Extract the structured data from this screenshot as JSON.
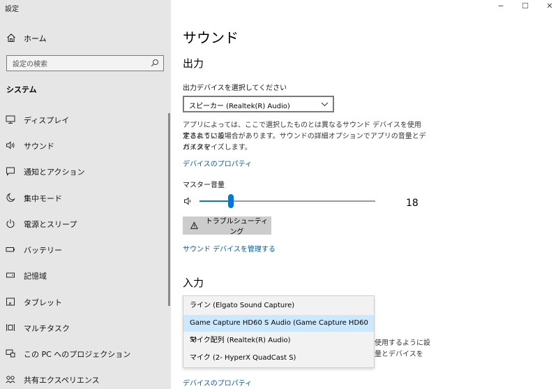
{
  "window": {
    "title": "設定",
    "minimize": "−",
    "maximize": "☐",
    "close": "✕"
  },
  "sidebar": {
    "home_label": "ホーム",
    "search_placeholder": "設定の検索",
    "section_title": "システム",
    "items": [
      {
        "label": "ディスプレイ",
        "icon": "display-icon"
      },
      {
        "label": "サウンド",
        "icon": "speaker-icon"
      },
      {
        "label": "通知とアクション",
        "icon": "notification-icon"
      },
      {
        "label": "集中モード",
        "icon": "moon-icon"
      },
      {
        "label": "電源とスリープ",
        "icon": "power-icon"
      },
      {
        "label": "バッテリー",
        "icon": "battery-icon"
      },
      {
        "label": "記憶域",
        "icon": "storage-icon"
      },
      {
        "label": "タブレット",
        "icon": "tablet-icon"
      },
      {
        "label": "マルチタスク",
        "icon": "multitask-icon"
      },
      {
        "label": "この PC へのプロジェクション",
        "icon": "projection-icon"
      },
      {
        "label": "共有エクスペリエンス",
        "icon": "shared-icon"
      }
    ]
  },
  "main": {
    "title": "サウンド",
    "output": {
      "heading": "出力",
      "select_label": "出力デバイスを選択してください",
      "selected_device": "スピーカー (Realtek(R) Audio)",
      "description_lines": [
        "アプリによっては、ここで選択したものとは異なるサウンド デバイスを使用するように設",
        "定されている場合があります。サウンドの詳細オプションでアプリの音量とデバイスを",
        "カスタマイズします。"
      ],
      "properties_link": "デバイスのプロパティ",
      "master_volume_label": "マスター音量",
      "master_volume": 18,
      "troubleshoot_label": "トラブルシューティング",
      "manage_link": "サウンド デバイスを管理する"
    },
    "input": {
      "heading": "入力",
      "options": [
        "ライン (Elgato Sound Capture)",
        "Game Capture HD60 S Audio (Game Capture HD60 S)",
        "マイク配列 (Realtek(R) Audio)",
        "マイク (2- HyperX QuadCast S)"
      ],
      "highlighted_index": 1,
      "partial_text_lines": [
        "使用するように設",
        "量とデバイスを"
      ],
      "properties_link": "デバイスのプロパティ"
    }
  }
}
